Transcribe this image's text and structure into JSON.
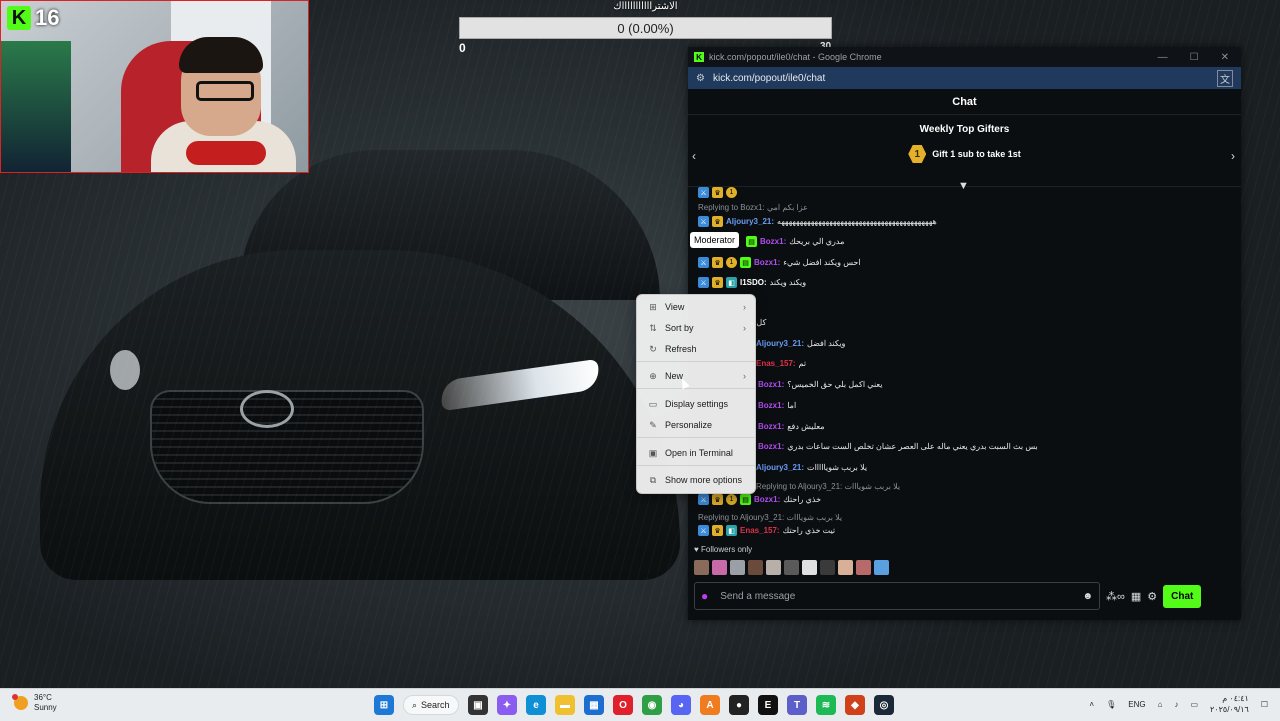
{
  "webcam": {
    "viewer_count": "16",
    "logo_letter": "K"
  },
  "poll": {
    "title": "الاشتراااااااااااك",
    "value_text": "0 (0.00%)",
    "min_label": "0",
    "max_label": "30"
  },
  "browser": {
    "window_title": "kick.com/popout/ile0/chat - Google Chrome",
    "url": "kick.com/popout/ile0/chat",
    "controls": {
      "minimize": "—",
      "maximize": "☐",
      "close": "✕"
    }
  },
  "chat": {
    "header": "Chat",
    "gifters_title": "Weekly Top Gifters",
    "gifters_rank": "1",
    "gifters_cta": "Gift 1 sub to take 1st",
    "tooltip": "Moderator",
    "messages": [
      {
        "reply": "",
        "user": "",
        "text": "",
        "user_color": "#ffffff"
      },
      {
        "reply": "Replying to Bozx1: عزا بكم امي",
        "user": "",
        "text": "",
        "user_color": "#8b9096"
      },
      {
        "reply": "",
        "user": "Aljoury3_21:",
        "text": "ههههههههههههههههههههههههههههههههههههههههههه",
        "user_color": "#6a9cf5"
      },
      {
        "reply": "",
        "user": "Bozx1:",
        "text": "مدري الي بريحك",
        "user_color": "#b04cf0"
      },
      {
        "reply": "",
        "user": "Bozx1:",
        "text": "احس ويكند افضل شيء",
        "user_color": "#b04cf0"
      },
      {
        "reply": "",
        "user": "I1SDO:",
        "text": "ويكند ويكند",
        "user_color": "#ffffff"
      },
      {
        "reply": "",
        "user": "",
        "text": "كل ه",
        "user_color": "#ffffff"
      },
      {
        "reply": "",
        "user": "Aljoury3_21:",
        "text": "ويكند افضل",
        "user_color": "#6a9cf5"
      },
      {
        "reply": "",
        "user": "Enas_157:",
        "text": "تم",
        "user_color": "#e0304a"
      },
      {
        "reply": "",
        "user": "Bozx1:",
        "text": "يعني اكمل بلي حق الخميس؟",
        "user_color": "#b04cf0"
      },
      {
        "reply": "",
        "user": "Bozx1:",
        "text": "اما",
        "user_color": "#b04cf0"
      },
      {
        "reply": "",
        "user": "Bozx1:",
        "text": "معليش دفع",
        "user_color": "#b04cf0"
      },
      {
        "reply": "",
        "user": "Bozx1:",
        "text": "بس بث السبت بدري يعني ماله على العصر عشان تخلص الست ساعات بدري",
        "user_color": "#b04cf0"
      },
      {
        "reply": "",
        "user": "Aljoury3_21:",
        "text": "يلا بربب شويااااات",
        "user_color": "#6a9cf5"
      },
      {
        "reply": "Replying to Aljoury3_21: يلا بربب شويااات",
        "user": "",
        "text": "",
        "user_color": "#8b9096"
      },
      {
        "reply": "",
        "user": "Bozx1:",
        "text": "خذي راحتك",
        "user_color": "#b04cf0"
      },
      {
        "reply": "Replying to Aljoury3_21: يلا بربب شويااات",
        "user": "",
        "text": "",
        "user_color": "#8b9096"
      },
      {
        "reply": "",
        "user": "Enas_157:",
        "text": "تيت خذي راحتك",
        "user_color": "#e0304a"
      }
    ],
    "followers_label": "Followers only",
    "input_placeholder": "Send a message",
    "send_label": "Chat"
  },
  "context_menu": {
    "items": [
      {
        "label": "View",
        "icon": "grid-icon",
        "glyph": "⊞",
        "submenu": true
      },
      {
        "label": "Sort by",
        "icon": "sort-icon",
        "glyph": "⇅",
        "submenu": true
      },
      {
        "label": "Refresh",
        "icon": "refresh-icon",
        "glyph": "↻",
        "submenu": false
      },
      {
        "label": "New",
        "icon": "new-icon",
        "glyph": "⊕",
        "submenu": true
      },
      {
        "label": "Display settings",
        "icon": "display-icon",
        "glyph": "▭",
        "submenu": false
      },
      {
        "label": "Personalize",
        "icon": "brush-icon",
        "glyph": "✎",
        "submenu": false
      },
      {
        "label": "Open in Terminal",
        "icon": "terminal-icon",
        "glyph": "▣",
        "submenu": false
      },
      {
        "label": "Show more options",
        "icon": "more-options-icon",
        "glyph": "⧉",
        "submenu": false
      }
    ]
  },
  "taskbar": {
    "weather_temp": "36°C",
    "weather_desc": "Sunny",
    "search_label": "Search",
    "language": "ENG",
    "time": "٠٤:٤١ م",
    "date": "٢٠٢٥/٠٩/١٦"
  },
  "colors": {
    "kick_green": "#53fc18",
    "taskbar_bg": "#e9ecef",
    "chat_bg": "#0b0e10",
    "urlbar_bg": "#1f3a5c"
  }
}
